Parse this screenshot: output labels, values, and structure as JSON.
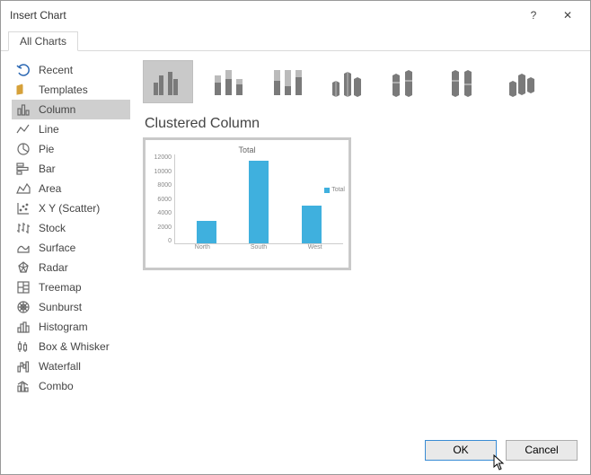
{
  "dialog": {
    "title": "Insert Chart",
    "help_label": "?",
    "close_label": "✕"
  },
  "tabs": {
    "all_charts": "All Charts"
  },
  "sidebar": {
    "items": [
      {
        "label": "Recent",
        "icon": "recent-icon"
      },
      {
        "label": "Templates",
        "icon": "templates-icon"
      },
      {
        "label": "Column",
        "icon": "column-icon",
        "selected": true
      },
      {
        "label": "Line",
        "icon": "line-icon"
      },
      {
        "label": "Pie",
        "icon": "pie-icon"
      },
      {
        "label": "Bar",
        "icon": "bar-icon"
      },
      {
        "label": "Area",
        "icon": "area-icon"
      },
      {
        "label": "X Y (Scatter)",
        "icon": "scatter-icon"
      },
      {
        "label": "Stock",
        "icon": "stock-icon"
      },
      {
        "label": "Surface",
        "icon": "surface-icon"
      },
      {
        "label": "Radar",
        "icon": "radar-icon"
      },
      {
        "label": "Treemap",
        "icon": "treemap-icon"
      },
      {
        "label": "Sunburst",
        "icon": "sunburst-icon"
      },
      {
        "label": "Histogram",
        "icon": "histogram-icon"
      },
      {
        "label": "Box & Whisker",
        "icon": "box-whisker-icon"
      },
      {
        "label": "Waterfall",
        "icon": "waterfall-icon"
      },
      {
        "label": "Combo",
        "icon": "combo-icon"
      }
    ]
  },
  "subtypes": {
    "names": [
      "clustered-column",
      "stacked-column",
      "100-stacked-column",
      "3d-clustered-column",
      "3d-stacked-column",
      "3d-100-stacked-column",
      "3d-column"
    ],
    "selected_index": 0
  },
  "chart_title": "Clustered Column",
  "footer": {
    "ok": "OK",
    "cancel": "Cancel"
  },
  "chart_data": {
    "type": "bar",
    "title": "Total",
    "categories": [
      "North",
      "South",
      "West"
    ],
    "series": [
      {
        "name": "Total",
        "values": [
          3000,
          11000,
          5000
        ]
      }
    ],
    "ylabel": "",
    "xlabel": "",
    "ylim": [
      0,
      12000
    ],
    "yticks": [
      0,
      2000,
      4000,
      6000,
      8000,
      10000,
      12000
    ],
    "legend_position": "right",
    "grid": false
  }
}
